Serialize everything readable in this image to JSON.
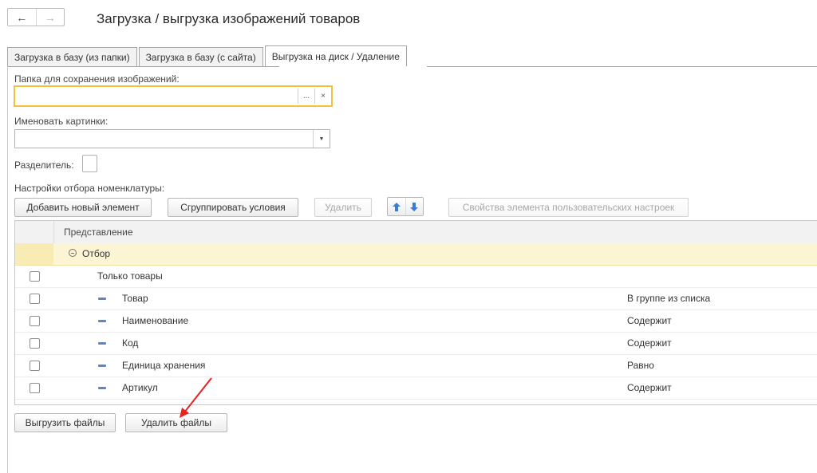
{
  "window": {
    "title": "Загрузка / выгрузка изображений товаров",
    "back_icon": "←",
    "forward_icon": "→"
  },
  "tabs": [
    {
      "label": "Загрузка в базу (из папки)",
      "active": false
    },
    {
      "label": "Загрузка в базу (с сайта)",
      "active": false
    },
    {
      "label": "Выгрузка на диск / Удаление",
      "active": true
    }
  ],
  "form": {
    "folder_label": "Папка для сохранения изображений:",
    "folder_value": "",
    "folder_select_btn": "...",
    "folder_clear_btn": "×",
    "name_label": "Именовать картинки:",
    "name_value": "",
    "separator_label": "Разделитель:",
    "separator_value": "",
    "filter_label": "Настройки отбора номенклатуры:"
  },
  "toolbar": {
    "add_label": "Добавить новый элемент",
    "group_label": "Сгруппировать условия",
    "delete_label": "Удалить",
    "props_label": "Свойства элемента пользовательских настроек"
  },
  "table": {
    "header": "Представление",
    "group_row": "Отбор",
    "rows": [
      {
        "name": "Только товары",
        "condition": "",
        "checked": false
      },
      {
        "name": "Товар",
        "condition": "В группе из списка",
        "checked": false
      },
      {
        "name": "Наименование",
        "condition": "Содержит",
        "checked": false
      },
      {
        "name": "Код",
        "condition": "Содержит",
        "checked": false
      },
      {
        "name": "Единица хранения",
        "condition": "Равно",
        "checked": false
      },
      {
        "name": "Артикул",
        "condition": "Содержит",
        "checked": false
      }
    ]
  },
  "actions": {
    "export_label": "Выгрузить файлы",
    "delete_files_label": "Удалить файлы"
  },
  "colors": {
    "accent_focus": "#f2c13e",
    "group_row_bg": "#fbf5d3",
    "annotation_arrow": "#e8231f",
    "move_arrow": "#3d7bd1"
  }
}
